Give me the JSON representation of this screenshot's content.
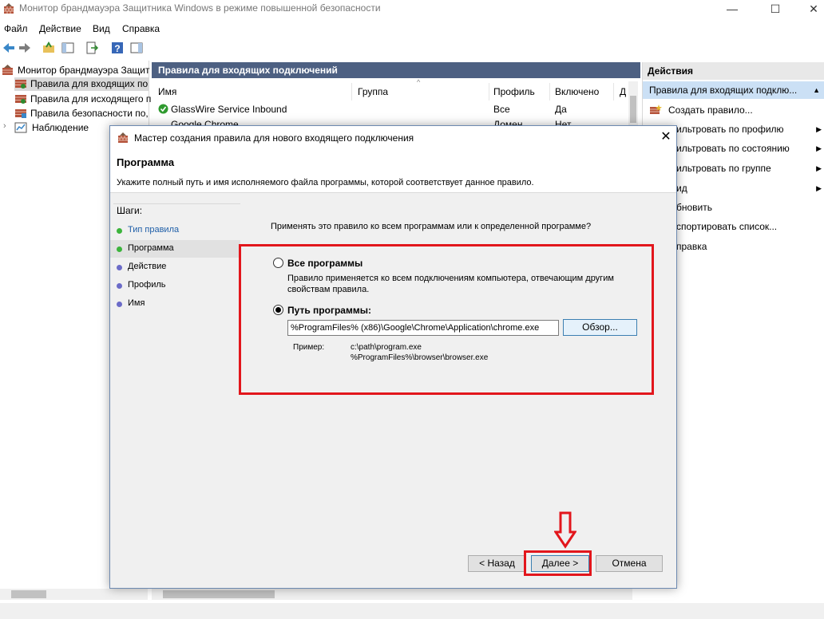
{
  "window": {
    "title": "Монитор брандмауэра Защитника Windows в режиме повышенной безопасности",
    "minimize": "—",
    "maximize": "☐",
    "close": "✕"
  },
  "menu": [
    "Файл",
    "Действие",
    "Вид",
    "Справка"
  ],
  "tree": {
    "items": [
      {
        "label": "Монитор брандмауэра Защит",
        "icon": "firewall-icon"
      },
      {
        "label": "Правила для входящих по",
        "icon": "inbound-rules-icon"
      },
      {
        "label": "Правила для исходящего п",
        "icon": "outbound-rules-icon"
      },
      {
        "label": "Правила безопасности по,",
        "icon": "security-rules-icon"
      },
      {
        "label": "Наблюдение",
        "icon": "monitoring-icon"
      }
    ]
  },
  "middle": {
    "header": "Правила для входящих подключений",
    "columns": [
      "Имя",
      "Группа",
      "Профиль",
      "Включено",
      "Д"
    ],
    "rows": [
      {
        "name": "GlassWire Service Inbound",
        "group": "",
        "profile": "Все",
        "enabled": "Да"
      },
      {
        "name": "Google Chrome",
        "group": "",
        "profile": "Домен",
        "enabled": "Нет"
      }
    ]
  },
  "actions": {
    "header": "Действия",
    "section": "Правила для входящих подклю...",
    "items": [
      {
        "label": "Создать правило...",
        "arrow": false
      },
      {
        "label": "ильтровать по профилю",
        "arrow": true
      },
      {
        "label": "ильтровать по состоянию",
        "arrow": true
      },
      {
        "label": "ильтровать по группе",
        "arrow": true
      },
      {
        "label": "ид",
        "arrow": true
      },
      {
        "label": "бновить",
        "arrow": false
      },
      {
        "label": "спортировать список...",
        "arrow": false
      },
      {
        "label": "правка",
        "arrow": false
      }
    ]
  },
  "dialog": {
    "title": "Мастер создания правила для нового входящего подключения",
    "close": "✕",
    "heading": "Программа",
    "description": "Укажите полный путь и имя исполняемого файла программы, которой соответствует данное правило.",
    "steps_label": "Шаги:",
    "steps": [
      {
        "label": "Тип правила",
        "state": "done"
      },
      {
        "label": "Программа",
        "state": "current"
      },
      {
        "label": "Действие",
        "state": "pending"
      },
      {
        "label": "Профиль",
        "state": "pending"
      },
      {
        "label": "Имя",
        "state": "pending"
      }
    ],
    "question": "Применять это правило ко всем программам или к определенной программе?",
    "option_all": "Все программы",
    "option_all_desc": "Правило применяется ко всем подключениям компьютера, отвечающим другим свойствам правила.",
    "option_path": "Путь программы:",
    "selected": "path",
    "path_value": "%ProgramFiles% (x86)\\Google\\Chrome\\Application\\chrome.exe",
    "browse": "Обзор...",
    "example_label": "Пример:",
    "example_1": "c:\\path\\program.exe",
    "example_2": "%ProgramFiles%\\browser\\browser.exe",
    "back": "< Назад",
    "next": "Далее >",
    "cancel": "Отмена"
  },
  "colors": {
    "accent_header": "#4d6082",
    "highlight": "#e2161c",
    "selection": "#cbe0f5"
  }
}
